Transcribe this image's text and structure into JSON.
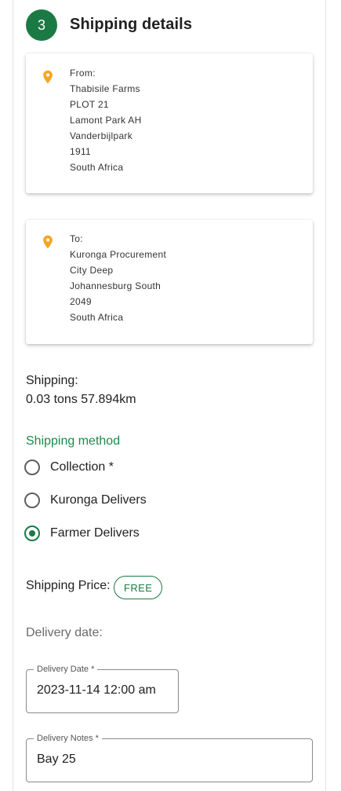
{
  "step": {
    "number": "3",
    "title": "Shipping details"
  },
  "from": {
    "label": "From:",
    "lines": [
      "Thabisile Farms",
      "PLOT 21",
      "Lamont Park AH",
      "Vanderbijlpark",
      "1911",
      "South Africa"
    ]
  },
  "to": {
    "label": "To:",
    "lines": [
      "Kuronga Procurement",
      "City Deep",
      "Johannesburg South",
      "2049",
      "South Africa"
    ]
  },
  "shipping": {
    "label": "Shipping:",
    "value": "0.03 tons 57.894km"
  },
  "method": {
    "label": "Shipping method",
    "options": [
      {
        "label": "Collection *",
        "checked": false
      },
      {
        "label": "Kuronga Delivers",
        "checked": false
      },
      {
        "label": "Farmer Delivers",
        "checked": true
      }
    ]
  },
  "price": {
    "label": "Shipping Price:",
    "value": "FREE"
  },
  "delivery": {
    "section_label": "Delivery date:",
    "date_label": "Delivery Date *",
    "date_value": "2023-11-14 12:00 am",
    "notes_label": "Delivery Notes *",
    "notes_value": "Bay 25"
  },
  "colors": {
    "accent": "#1b7a43",
    "pin": "#f5a623"
  },
  "icons": {
    "pin": "location-pin-icon"
  }
}
